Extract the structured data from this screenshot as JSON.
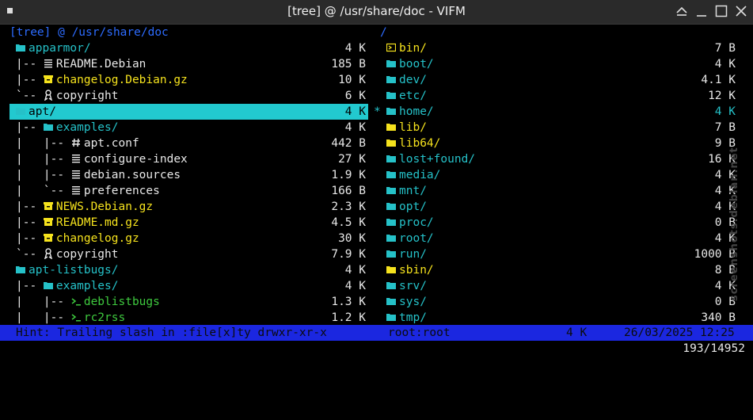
{
  "window": {
    "title": "[tree] @ /usr/share/doc - VIFM"
  },
  "left_pane": {
    "header": "[tree] @ /usr/share/doc",
    "entries": [
      {
        "prefix": "",
        "icon": "folder",
        "name": "apparmor/",
        "size": "4 K",
        "kind": "dir"
      },
      {
        "prefix": "|-- ",
        "icon": "doc",
        "name": "README.Debian",
        "size": "185 B",
        "kind": "file"
      },
      {
        "prefix": "|-- ",
        "icon": "archive",
        "name": "changelog.Debian.gz",
        "size": "10 K",
        "kind": "arch"
      },
      {
        "prefix": "`-- ",
        "icon": "license",
        "name": "copyright",
        "size": "6 K",
        "kind": "file"
      },
      {
        "prefix": "",
        "icon": "folder",
        "name": "apt/",
        "size": "4 K",
        "kind": "dir",
        "selected": true
      },
      {
        "prefix": "|-- ",
        "icon": "folder",
        "name": "examples/",
        "size": "4 K",
        "kind": "dir"
      },
      {
        "prefix": "|   |-- ",
        "icon": "hash",
        "name": "apt.conf",
        "size": "442 B",
        "kind": "file"
      },
      {
        "prefix": "|   |-- ",
        "icon": "doc",
        "name": "configure-index",
        "size": "27 K",
        "kind": "file"
      },
      {
        "prefix": "|   |-- ",
        "icon": "doc",
        "name": "debian.sources",
        "size": "1.9 K",
        "kind": "file"
      },
      {
        "prefix": "|   `-- ",
        "icon": "doc",
        "name": "preferences",
        "size": "166 B",
        "kind": "file"
      },
      {
        "prefix": "|-- ",
        "icon": "archive",
        "name": "NEWS.Debian.gz",
        "size": "2.3 K",
        "kind": "arch"
      },
      {
        "prefix": "|-- ",
        "icon": "archive",
        "name": "README.md.gz",
        "size": "4.5 K",
        "kind": "arch"
      },
      {
        "prefix": "|-- ",
        "icon": "archive",
        "name": "changelog.gz",
        "size": "30 K",
        "kind": "arch"
      },
      {
        "prefix": "`-- ",
        "icon": "license",
        "name": "copyright",
        "size": "7.9 K",
        "kind": "file"
      },
      {
        "prefix": "",
        "icon": "folder",
        "name": "apt-listbugs/",
        "size": "4 K",
        "kind": "dir"
      },
      {
        "prefix": "|-- ",
        "icon": "folder",
        "name": "examples/",
        "size": "4 K",
        "kind": "dir"
      },
      {
        "prefix": "|   |-- ",
        "icon": "exe",
        "name": "deblistbugs",
        "size": "1.3 K",
        "kind": "exe"
      },
      {
        "prefix": "|   |-- ",
        "icon": "exe",
        "name": "rc2rss",
        "size": "1.2 K",
        "kind": "exe"
      }
    ]
  },
  "right_pane": {
    "header": "/",
    "entries": [
      {
        "icon": "link",
        "name": "bin/",
        "size": "7 B",
        "kind": "sym"
      },
      {
        "icon": "folder",
        "name": "boot/",
        "size": "4 K",
        "kind": "dir"
      },
      {
        "icon": "folder",
        "name": "dev/",
        "size": "4.1 K",
        "kind": "dir"
      },
      {
        "icon": "folder",
        "name": "etc/",
        "size": "12 K",
        "kind": "dir"
      },
      {
        "icon": "folder",
        "name": "home/",
        "size": "4 K",
        "kind": "dir",
        "marker": "*"
      },
      {
        "icon": "folder-yellow",
        "name": "lib/",
        "size": "7 B",
        "kind": "sym"
      },
      {
        "icon": "folder-yellow",
        "name": "lib64/",
        "size": "9 B",
        "kind": "sym"
      },
      {
        "icon": "folder",
        "name": "lost+found/",
        "size": "16 K",
        "kind": "dir"
      },
      {
        "icon": "folder",
        "name": "media/",
        "size": "4 K",
        "kind": "dir"
      },
      {
        "icon": "folder",
        "name": "mnt/",
        "size": "4 K",
        "kind": "dir"
      },
      {
        "icon": "folder",
        "name": "opt/",
        "size": "4 K",
        "kind": "dir"
      },
      {
        "icon": "folder",
        "name": "proc/",
        "size": "0 B",
        "kind": "dir"
      },
      {
        "icon": "folder",
        "name": "root/",
        "size": "4 K",
        "kind": "dir"
      },
      {
        "icon": "folder",
        "name": "run/",
        "size": "1000 B",
        "kind": "dir"
      },
      {
        "icon": "folder-yellow",
        "name": "sbin/",
        "size": "8 B",
        "kind": "sym"
      },
      {
        "icon": "folder",
        "name": "srv/",
        "size": "4 K",
        "kind": "dir"
      },
      {
        "icon": "folder",
        "name": "sys/",
        "size": "0 B",
        "kind": "dir"
      },
      {
        "icon": "folder",
        "name": "tmp/",
        "size": "340 B",
        "kind": "dir"
      }
    ]
  },
  "status_bar": {
    "hint": "Hint: Trailing slash in :file[x]ty drwxr-xr-x",
    "owner": "root:root",
    "size": "4 K",
    "datetime": "26/03/2025 12:25"
  },
  "command_line": {
    "position": "193/14952"
  },
  "watermark": "screenshots.debian.net",
  "colors": {
    "dir": "#25c1c8",
    "archive": "#f5e21d",
    "exec": "#3ec93e",
    "selection": "#22c9cf",
    "status_bg": "#1b27e0",
    "header": "#2d6cff"
  }
}
